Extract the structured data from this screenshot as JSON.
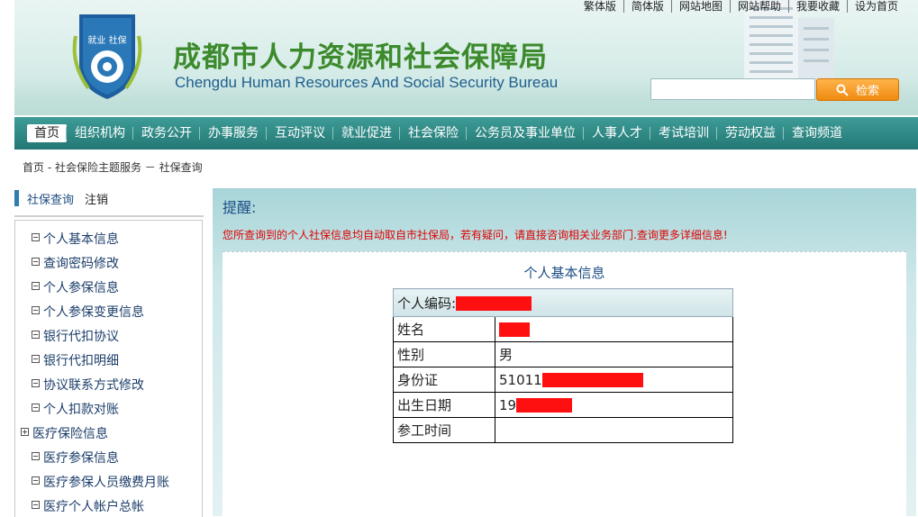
{
  "header": {
    "title_cn": "成都市人力资源和社会保障局",
    "title_en": "Chengdu Human Resources And Social Security Bureau",
    "logo_text": "就业 社保",
    "top_links": [
      "繁体版",
      "简体版",
      "网站地图",
      "网站帮助",
      "我要收藏",
      "设为首页"
    ],
    "search_placeholder": "",
    "search_button": "检索"
  },
  "nav": {
    "items": [
      "首页",
      "组织机构",
      "政务公开",
      "办事服务",
      "互动评议",
      "就业促进",
      "社会保险",
      "公务员及事业单位",
      "人事人才",
      "考试培训",
      "劳动权益",
      "查询频道"
    ],
    "active": "首页"
  },
  "breadcrumb": "首页 - 社会保险主题服务 － 社保查询",
  "sidebar": {
    "title": "社保查询",
    "logout": "注销",
    "items": [
      {
        "label": "个人基本信息",
        "mark": "minus"
      },
      {
        "label": "查询密码修改",
        "mark": "minus"
      },
      {
        "label": "个人参保信息",
        "mark": "minus"
      },
      {
        "label": "个人参保变更信息",
        "mark": "minus"
      },
      {
        "label": "银行代扣协议",
        "mark": "minus"
      },
      {
        "label": "银行代扣明细",
        "mark": "minus"
      },
      {
        "label": "协议联系方式修改",
        "mark": "minus"
      },
      {
        "label": "个人扣款对账",
        "mark": "minus"
      },
      {
        "label": "医疗保险信息",
        "mark": "plus"
      },
      {
        "label": "医疗参保信息",
        "mark": "minus"
      },
      {
        "label": "医疗参保人员缴费月账",
        "mark": "minus"
      },
      {
        "label": "医疗个人帐户总帐",
        "mark": "minus"
      }
    ]
  },
  "main": {
    "reminder_title": "提醒:",
    "notice": "您所查询到的个人社保信息均自动取自市社保局，若有疑问，请直接咨询相关业务部门.查询更多详细信息!",
    "section_title": "个人基本信息",
    "rows": {
      "code_label": "个人编码:",
      "name_label": "姓名",
      "name_value": "",
      "gender_label": "性别",
      "gender_value": "男",
      "id_label": "身份证",
      "id_value": "51011",
      "birth_label": "出生日期",
      "birth_value": "19",
      "work_label": "参工时间",
      "work_value": ""
    }
  }
}
